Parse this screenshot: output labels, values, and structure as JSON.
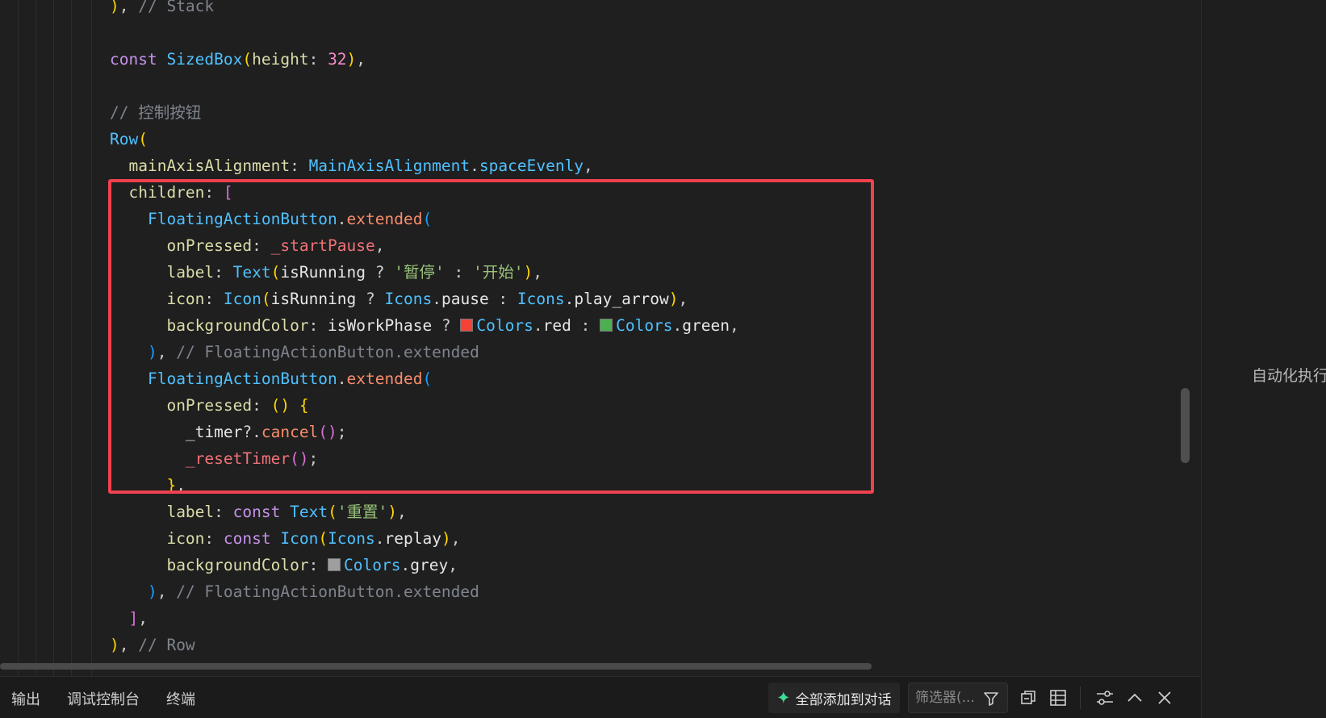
{
  "code_lines": [
    [
      [
        "t-b1",
        ")"
      ],
      [
        "t-punc",
        ", "
      ],
      [
        "t-comment",
        "// Stack"
      ]
    ],
    [],
    [
      [
        "t-kw2",
        "const "
      ],
      [
        "t-type",
        "SizedBox"
      ],
      [
        "t-b1",
        "("
      ],
      [
        "t-prop",
        "height"
      ],
      [
        "t-punc",
        ": "
      ],
      [
        "t-num",
        "32"
      ],
      [
        "t-b1",
        ")"
      ],
      [
        "t-punc",
        ","
      ]
    ],
    [],
    [
      [
        "t-comment",
        "// 控制按钮"
      ]
    ],
    [
      [
        "t-type",
        "Row"
      ],
      [
        "t-b1",
        "("
      ]
    ],
    [
      [
        "t-punc",
        "  "
      ],
      [
        "t-prop",
        "mainAxisAlignment"
      ],
      [
        "t-punc",
        ": "
      ],
      [
        "t-type",
        "MainAxisAlignment"
      ],
      [
        "t-punc",
        "."
      ],
      [
        "t-type",
        "spaceEvenly"
      ],
      [
        "t-punc",
        ","
      ]
    ],
    [
      [
        "t-punc",
        "  "
      ],
      [
        "t-prop",
        "children"
      ],
      [
        "t-punc",
        ": "
      ],
      [
        "t-b2",
        "["
      ]
    ],
    [
      [
        "t-punc",
        "    "
      ],
      [
        "t-type",
        "FloatingActionButton"
      ],
      [
        "t-punc",
        "."
      ],
      [
        "t-method",
        "extended"
      ],
      [
        "t-b3",
        "("
      ]
    ],
    [
      [
        "t-punc",
        "      "
      ],
      [
        "t-prop",
        "onPressed"
      ],
      [
        "t-punc",
        ": "
      ],
      [
        "t-pink",
        "_startPause"
      ],
      [
        "t-punc",
        ","
      ]
    ],
    [
      [
        "t-punc",
        "      "
      ],
      [
        "t-prop",
        "label"
      ],
      [
        "t-punc",
        ": "
      ],
      [
        "t-type",
        "Text"
      ],
      [
        "t-b1",
        "("
      ],
      [
        "t-var",
        "isRunning"
      ],
      [
        "t-punc",
        " ? "
      ],
      [
        "t-str",
        "'暂停'"
      ],
      [
        "t-punc",
        " : "
      ],
      [
        "t-str",
        "'开始'"
      ],
      [
        "t-b1",
        ")"
      ],
      [
        "t-punc",
        ","
      ]
    ],
    [
      [
        "t-punc",
        "      "
      ],
      [
        "t-prop",
        "icon"
      ],
      [
        "t-punc",
        ": "
      ],
      [
        "t-type",
        "Icon"
      ],
      [
        "t-b1",
        "("
      ],
      [
        "t-var",
        "isRunning"
      ],
      [
        "t-punc",
        " ? "
      ],
      [
        "t-type",
        "Icons"
      ],
      [
        "t-punc",
        "."
      ],
      [
        "t-var",
        "pause"
      ],
      [
        "t-punc",
        " : "
      ],
      [
        "t-type",
        "Icons"
      ],
      [
        "t-punc",
        "."
      ],
      [
        "t-var",
        "play_arrow"
      ],
      [
        "t-b1",
        ")"
      ],
      [
        "t-punc",
        ","
      ]
    ],
    [
      [
        "t-punc",
        "      "
      ],
      [
        "t-prop",
        "backgroundColor"
      ],
      [
        "t-punc",
        ": "
      ],
      [
        "t-var",
        "isWorkPhase"
      ],
      [
        "t-punc",
        " ? "
      ],
      [
        "swatch",
        "#f44336"
      ],
      [
        "t-type",
        "Colors"
      ],
      [
        "t-punc",
        "."
      ],
      [
        "t-var",
        "red"
      ],
      [
        "t-punc",
        " : "
      ],
      [
        "swatch",
        "#4caf50"
      ],
      [
        "t-type",
        "Colors"
      ],
      [
        "t-punc",
        "."
      ],
      [
        "t-var",
        "green"
      ],
      [
        "t-punc",
        ","
      ]
    ],
    [
      [
        "t-punc",
        "    "
      ],
      [
        "t-b3",
        ")"
      ],
      [
        "t-punc",
        ", "
      ],
      [
        "t-comment",
        "// FloatingActionButton.extended"
      ]
    ],
    [
      [
        "t-punc",
        "    "
      ],
      [
        "t-type",
        "FloatingActionButton"
      ],
      [
        "t-punc",
        "."
      ],
      [
        "t-method",
        "extended"
      ],
      [
        "t-b3",
        "("
      ]
    ],
    [
      [
        "t-punc",
        "      "
      ],
      [
        "t-prop",
        "onPressed"
      ],
      [
        "t-punc",
        ": "
      ],
      [
        "t-b1",
        "() {"
      ]
    ],
    [
      [
        "t-punc",
        "        "
      ],
      [
        "t-var",
        "_timer"
      ],
      [
        "t-punc",
        "?."
      ],
      [
        "t-method",
        "cancel"
      ],
      [
        "t-b2",
        "()"
      ],
      [
        "t-punc",
        ";"
      ]
    ],
    [
      [
        "t-punc",
        "        "
      ],
      [
        "t-pink",
        "_resetTimer"
      ],
      [
        "t-b2",
        "()"
      ],
      [
        "t-punc",
        ";"
      ]
    ],
    [
      [
        "t-punc",
        "      "
      ],
      [
        "t-b1",
        "}"
      ],
      [
        "t-punc",
        ","
      ]
    ],
    [
      [
        "t-punc",
        "      "
      ],
      [
        "t-prop",
        "label"
      ],
      [
        "t-punc",
        ": "
      ],
      [
        "t-kw2",
        "const "
      ],
      [
        "t-type",
        "Text"
      ],
      [
        "t-b1",
        "("
      ],
      [
        "t-str",
        "'重置'"
      ],
      [
        "t-b1",
        ")"
      ],
      [
        "t-punc",
        ","
      ]
    ],
    [
      [
        "t-punc",
        "      "
      ],
      [
        "t-prop",
        "icon"
      ],
      [
        "t-punc",
        ": "
      ],
      [
        "t-kw2",
        "const "
      ],
      [
        "t-type",
        "Icon"
      ],
      [
        "t-b1",
        "("
      ],
      [
        "t-type",
        "Icons"
      ],
      [
        "t-punc",
        "."
      ],
      [
        "t-var",
        "replay"
      ],
      [
        "t-b1",
        ")"
      ],
      [
        "t-punc",
        ","
      ]
    ],
    [
      [
        "t-punc",
        "      "
      ],
      [
        "t-prop",
        "backgroundColor"
      ],
      [
        "t-punc",
        ": "
      ],
      [
        "swatch",
        "#9e9e9e"
      ],
      [
        "t-type",
        "Colors"
      ],
      [
        "t-punc",
        "."
      ],
      [
        "t-var",
        "grey"
      ],
      [
        "t-punc",
        ","
      ]
    ],
    [
      [
        "t-punc",
        "    "
      ],
      [
        "t-b3",
        ")"
      ],
      [
        "t-punc",
        ", "
      ],
      [
        "t-comment",
        "// FloatingActionButton.extended"
      ]
    ],
    [
      [
        "t-punc",
        "  "
      ],
      [
        "t-b2",
        "]"
      ],
      [
        "t-punc",
        ","
      ]
    ],
    [
      [
        "t-b1",
        ")"
      ],
      [
        "t-punc",
        ", "
      ],
      [
        "t-comment",
        "// Row"
      ]
    ]
  ],
  "right_panel": {
    "label": "自动化执行"
  },
  "bottom_bar": {
    "tabs": [
      "输出",
      "调试控制台",
      "终端"
    ],
    "add_all_label": "全部添加到对话",
    "filter_placeholder": "筛选器(..."
  },
  "icons": [
    "sparkle-icon",
    "filter-icon",
    "collapse-all-icon",
    "table-view-icon",
    "settings-sliders-icon",
    "chevron-up-icon",
    "close-icon"
  ],
  "colors": {
    "highlight_border": "#f0414f",
    "accent_green": "#3ddc97"
  }
}
